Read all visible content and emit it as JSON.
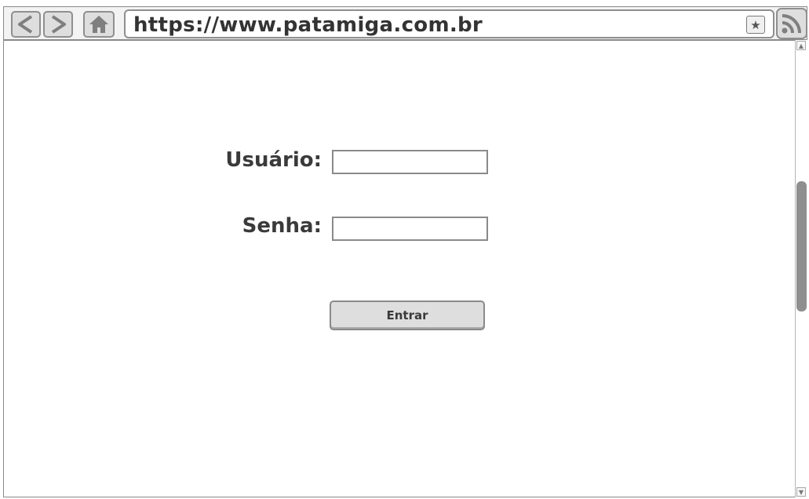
{
  "browser": {
    "url": "https://www.patamiga.com.br",
    "back_icon": "chevron-left-icon",
    "forward_icon": "chevron-right-icon",
    "home_icon": "home-icon",
    "bookmark_icon": "star-icon",
    "feed_icon": "rss-icon"
  },
  "login": {
    "username_label": "Usuário:",
    "username_value": "",
    "password_label": "Senha:",
    "password_value": "",
    "submit_label": "Entrar"
  }
}
